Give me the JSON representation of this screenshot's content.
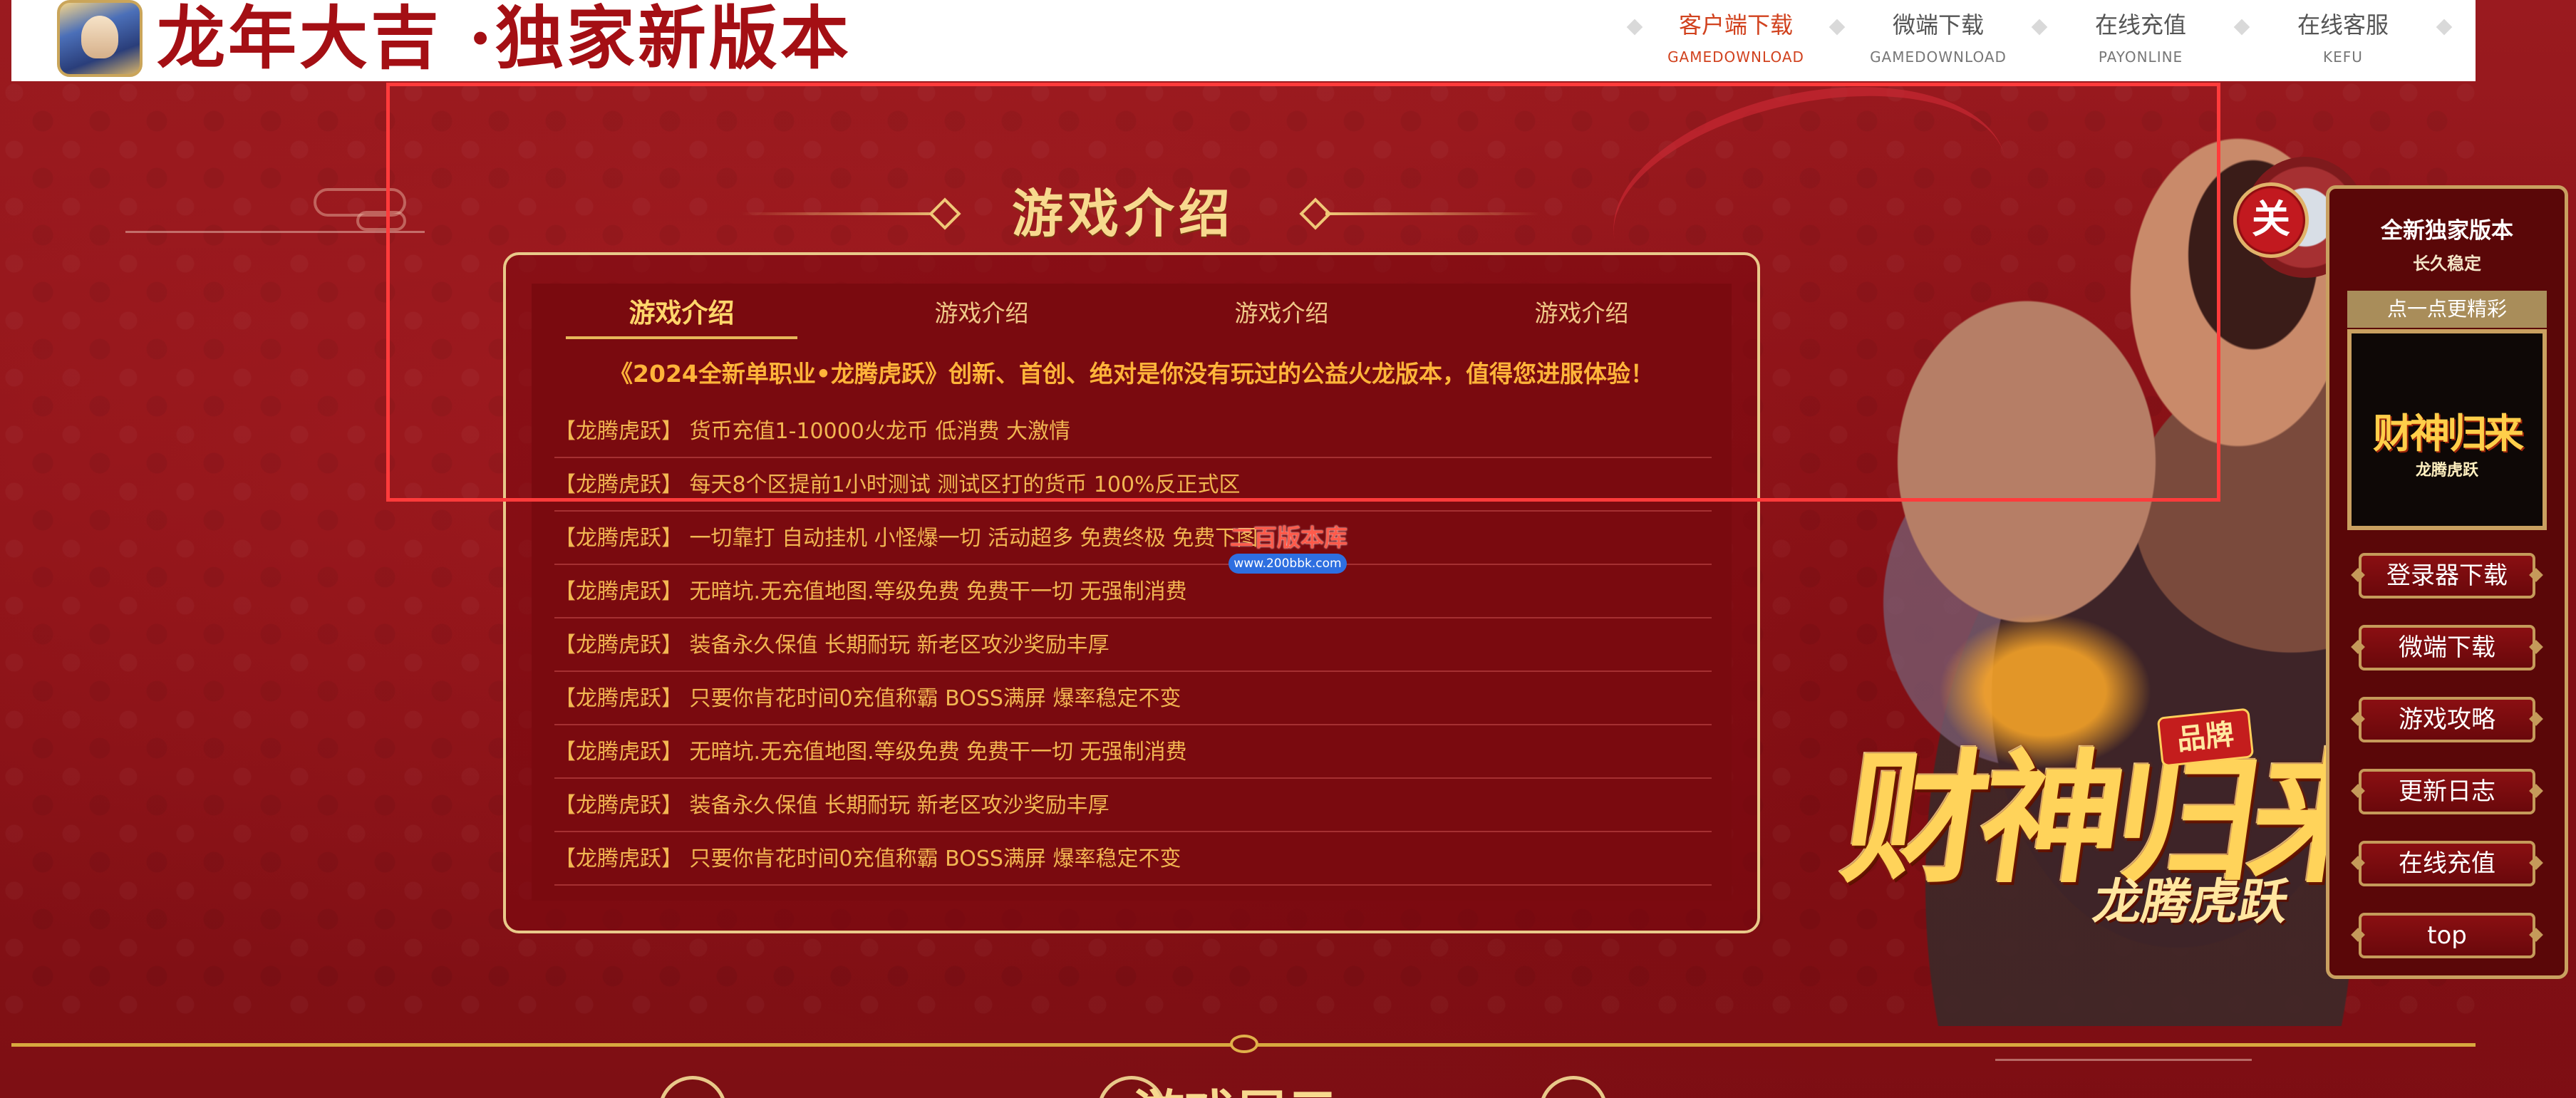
{
  "header": {
    "title": "龙年大吉 ·独家新版本",
    "nav": [
      {
        "cn": "客户端下载",
        "en": "GAMEDOWNLOAD",
        "active": true
      },
      {
        "cn": "微端下载",
        "en": "GAMEDOWNLOAD",
        "active": false
      },
      {
        "cn": "在线充值",
        "en": "PAYONLINE",
        "active": false
      },
      {
        "cn": "在线客服",
        "en": "KEFU",
        "active": false
      }
    ]
  },
  "section": {
    "title": "游戏介绍"
  },
  "tabs": [
    "游戏介绍",
    "游戏介绍",
    "游戏介绍",
    "游戏介绍"
  ],
  "headline": "《2024全新单职业•龙腾虎跃》创新、首创、绝对是你没有玩过的公益火龙版本，值得您进服体验！",
  "news": [
    "【龙腾虎跃】 货币充值1-10000火龙币 低消费 大激情",
    "【龙腾虎跃】 每天8个区提前1小时测试 测试区打的货币 100%反正式区",
    "【龙腾虎跃】 一切靠打 自动挂机 小怪爆一切 活动超多 免费终极 免费下图",
    "【龙腾虎跃】 无暗坑.无充值地图.等级免费 免费干一切 无强制消费",
    "【龙腾虎跃】 装备永久保值 长期耐玩 新老区攻沙奖励丰厚",
    "【龙腾虎跃】 只要你肯花时间0充值称霸 BOSS满屏 爆率稳定不变",
    "【龙腾虎跃】 无暗坑.无充值地图.等级免费 免费干一切 无强制消费",
    "【龙腾虎跃】 装备永久保值 长期耐玩 新老区攻沙奖励丰厚",
    "【龙腾虎跃】 只要你肯花时间0充值称霸 BOSS满屏 爆率稳定不变"
  ],
  "watermark": {
    "text": "二百版本库",
    "url": "www.200bbk.com"
  },
  "hero": {
    "brand": "财神归来",
    "sub": "龙腾虎跃",
    "badge": "品牌"
  },
  "sidebar": {
    "close": "关",
    "line1": "全新独家版本",
    "line2": "长久稳定",
    "tag": "点一点更精彩",
    "thumb_title": "财神归来",
    "thumb_sub": "龙腾虎跃",
    "buttons": [
      "登录器下载",
      "微端下载",
      "游戏攻略",
      "更新日志",
      "在线充值",
      "top"
    ]
  },
  "bottom": {
    "title": "游戏展示"
  },
  "colors": {
    "background": "#8f1419",
    "accent_gold": "#f7d98e",
    "active_nav": "#d1421e",
    "highlight_box": "#ff3b3b"
  }
}
